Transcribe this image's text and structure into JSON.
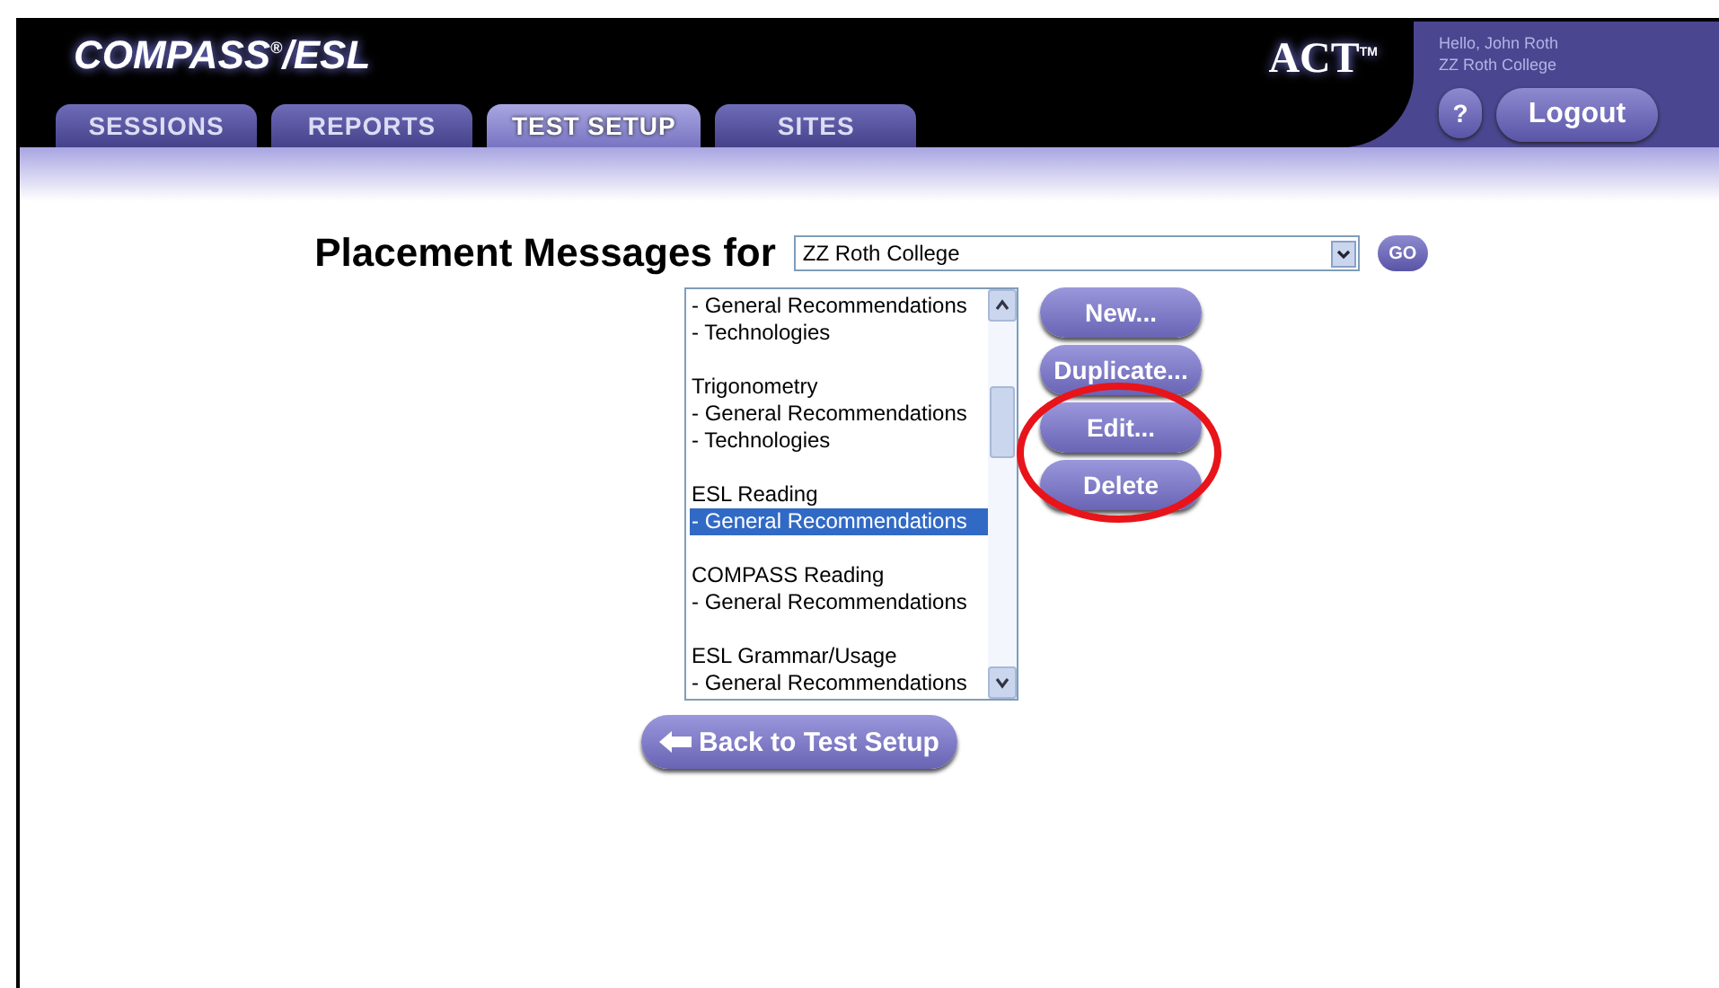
{
  "header": {
    "logo": "COMPASS",
    "logo_mark": "®",
    "logo_suffix": "/ESL",
    "brand": "ACT",
    "brand_mark": "TM",
    "greeting": "Hello, John Roth",
    "institution": "ZZ Roth College",
    "help": "?",
    "logout": "Logout"
  },
  "tabs": [
    {
      "label": "SESSIONS",
      "selected": false
    },
    {
      "label": "REPORTS",
      "selected": false
    },
    {
      "label": "TEST SETUP",
      "selected": true
    },
    {
      "label": "SITES",
      "selected": false
    }
  ],
  "heading": "Placement Messages for",
  "college_select": {
    "value": "ZZ Roth College"
  },
  "go": "GO",
  "messages": [
    {
      "kind": "item",
      "text": "- General Recommendations",
      "selected": false
    },
    {
      "kind": "item",
      "text": "- Technologies",
      "selected": false
    },
    {
      "kind": "blank"
    },
    {
      "kind": "item",
      "text": "Trigonometry",
      "selected": false
    },
    {
      "kind": "item",
      "text": "- General Recommendations",
      "selected": false
    },
    {
      "kind": "item",
      "text": "- Technologies",
      "selected": false
    },
    {
      "kind": "blank"
    },
    {
      "kind": "item",
      "text": "ESL Reading",
      "selected": false
    },
    {
      "kind": "item",
      "text": "- General Recommendations",
      "selected": true
    },
    {
      "kind": "blank"
    },
    {
      "kind": "item",
      "text": "COMPASS Reading",
      "selected": false
    },
    {
      "kind": "item",
      "text": "- General Recommendations",
      "selected": false
    },
    {
      "kind": "blank"
    },
    {
      "kind": "item",
      "text": "ESL Grammar/Usage",
      "selected": false
    },
    {
      "kind": "item",
      "text": "- General Recommendations",
      "selected": false
    }
  ],
  "actions": [
    "New...",
    "Duplicate...",
    "Edit...",
    "Delete"
  ],
  "back": "Back to Test Setup"
}
